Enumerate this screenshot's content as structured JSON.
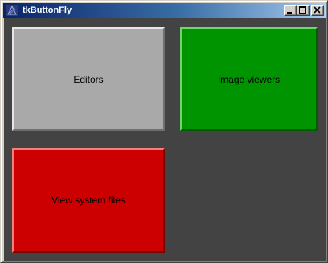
{
  "window": {
    "title": "tkButtonFly",
    "icon": "tk-feather-icon",
    "controls": {
      "minimize_icon": "minimize-icon",
      "maximize_icon": "maximize-icon",
      "close_icon": "close-icon"
    }
  },
  "buttons": [
    {
      "label": "Editors",
      "color": "#a9a9a9"
    },
    {
      "label": "Image viewers",
      "color": "#009400"
    },
    {
      "label": "View system files",
      "color": "#cc0000"
    }
  ],
  "colors": {
    "background": "#434343",
    "titlebar_start": "#0a246a",
    "titlebar_end": "#a6caf0"
  }
}
